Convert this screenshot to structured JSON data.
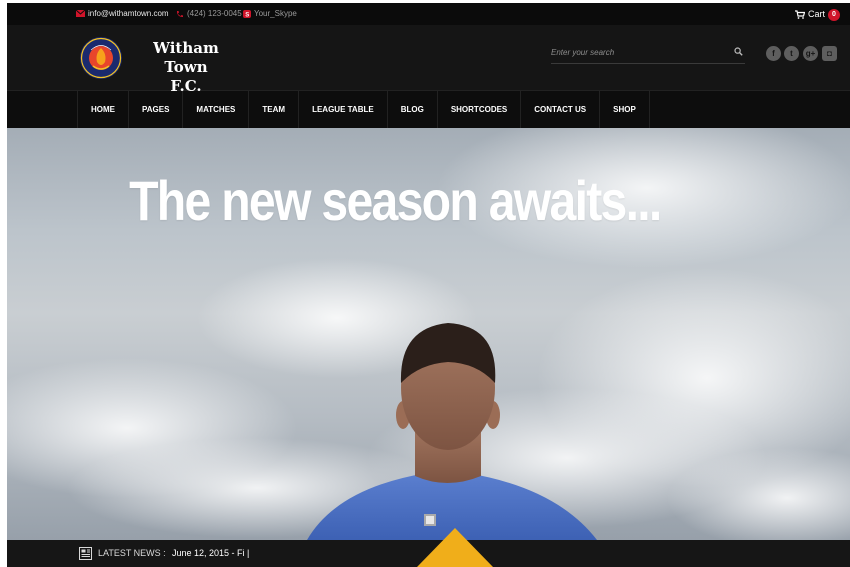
{
  "topbar": {
    "email": "info@withamtown.com",
    "phone": "(424) 123-0045",
    "skype": "Your_Skype",
    "cart_label": "Cart",
    "cart_count": "0"
  },
  "brand": {
    "name_line1": "Witham Town",
    "name_line2": "F.C.",
    "crest_text_top": "WITHAM TOWN",
    "crest_text_bottom": "FOOTBALL CLUB"
  },
  "search": {
    "placeholder": "Enter your search"
  },
  "social": [
    {
      "icon": "facebook-icon",
      "glyph": "f"
    },
    {
      "icon": "twitter-icon",
      "glyph": "t"
    },
    {
      "icon": "google-plus-icon",
      "glyph": "g+"
    },
    {
      "icon": "instagram-icon",
      "glyph": "◘"
    }
  ],
  "nav": {
    "items": [
      "HOME",
      "PAGES",
      "MATCHES",
      "TEAM",
      "LEAGUE TABLE",
      "BLOG",
      "SHORTCODES",
      "CONTACT US",
      "SHOP"
    ]
  },
  "hero": {
    "title": "The new season awaits..."
  },
  "news": {
    "label": "LATEST NEWS :",
    "text": "June 12, 2015 - Fi |"
  },
  "colors": {
    "accent": "#f0ae1a",
    "badge": "#d0142a",
    "dark": "#111111"
  }
}
